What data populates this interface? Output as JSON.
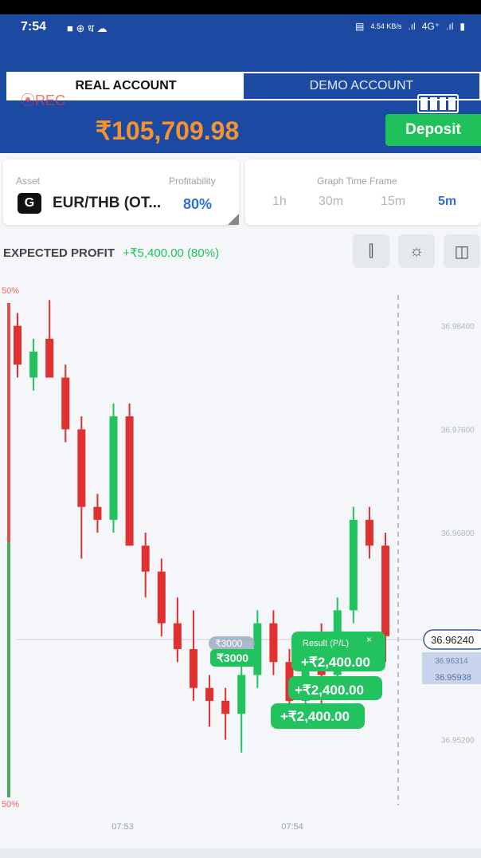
{
  "status": {
    "time": "7:54",
    "network": "4G⁺",
    "speed": "4.54 KB/s"
  },
  "accounts": {
    "real": "REAL ACCOUNT",
    "demo": "DEMO ACCOUNT"
  },
  "rec": "⦿REC",
  "balance": "₹105,709.98",
  "deposit": "Deposit",
  "asset": {
    "label": "Asset",
    "name": "EUR/THB (OT...",
    "icon": "G",
    "profit_label": "Profitability",
    "profit": "80%"
  },
  "timeframe": {
    "label": "Graph Time Frame",
    "options": [
      "1h",
      "30m",
      "15m",
      "5m"
    ],
    "active": "5m"
  },
  "expected_profit": {
    "label": "EXPECTED PROFIT",
    "value": "+₹5,400.00 (80%)"
  },
  "tools": [
    "candles-icon",
    "sun-icon",
    "layout-icon"
  ],
  "chart_data": {
    "type": "candlestick",
    "x_ticks": [
      "07:53",
      "07:54"
    ],
    "y_ticks": [
      "36.98400",
      "36.97600",
      "36.96800",
      "36.95200"
    ],
    "side_labels": [
      "50%",
      "50%"
    ],
    "current_price": "36.96240",
    "price_tags": [
      "36.96314",
      "36.95938"
    ],
    "trades": [
      "₹3000",
      "₹3000"
    ],
    "result_label": "Result (P/L)",
    "results": [
      "+₹2,400.00",
      "+₹2,400.00",
      "+₹2,400.00"
    ],
    "candles": [
      {
        "o": 36.984,
        "h": 36.985,
        "l": 36.98,
        "c": 36.981,
        "up": false
      },
      {
        "o": 36.98,
        "h": 36.983,
        "l": 36.979,
        "c": 36.982,
        "up": true
      },
      {
        "o": 36.983,
        "h": 36.986,
        "l": 36.98,
        "c": 36.98,
        "up": false
      },
      {
        "o": 36.98,
        "h": 36.981,
        "l": 36.975,
        "c": 36.976,
        "up": false
      },
      {
        "o": 36.976,
        "h": 36.977,
        "l": 36.966,
        "c": 36.97,
        "up": false
      },
      {
        "o": 36.97,
        "h": 36.971,
        "l": 36.968,
        "c": 36.969,
        "up": false
      },
      {
        "o": 36.969,
        "h": 36.978,
        "l": 36.968,
        "c": 36.977,
        "up": true
      },
      {
        "o": 36.977,
        "h": 36.978,
        "l": 36.967,
        "c": 36.967,
        "up": false
      },
      {
        "o": 36.967,
        "h": 36.968,
        "l": 36.963,
        "c": 36.965,
        "up": false
      },
      {
        "o": 36.965,
        "h": 36.966,
        "l": 36.96,
        "c": 36.961,
        "up": false
      },
      {
        "o": 36.961,
        "h": 36.963,
        "l": 36.958,
        "c": 36.959,
        "up": false
      },
      {
        "o": 36.959,
        "h": 36.962,
        "l": 36.955,
        "c": 36.956,
        "up": false
      },
      {
        "o": 36.956,
        "h": 36.957,
        "l": 36.953,
        "c": 36.955,
        "up": false
      },
      {
        "o": 36.955,
        "h": 36.956,
        "l": 36.952,
        "c": 36.954,
        "up": false
      },
      {
        "o": 36.954,
        "h": 36.958,
        "l": 36.951,
        "c": 36.957,
        "up": true
      },
      {
        "o": 36.957,
        "h": 36.962,
        "l": 36.956,
        "c": 36.961,
        "up": true
      },
      {
        "o": 36.961,
        "h": 36.962,
        "l": 36.957,
        "c": 36.958,
        "up": false
      },
      {
        "o": 36.958,
        "h": 36.959,
        "l": 36.954,
        "c": 36.955,
        "up": false
      },
      {
        "o": 36.955,
        "h": 36.96,
        "l": 36.953,
        "c": 36.959,
        "up": true
      },
      {
        "o": 36.959,
        "h": 36.961,
        "l": 36.954,
        "c": 36.957,
        "up": false
      },
      {
        "o": 36.957,
        "h": 36.963,
        "l": 36.956,
        "c": 36.962,
        "up": true
      },
      {
        "o": 36.962,
        "h": 36.97,
        "l": 36.961,
        "c": 36.969,
        "up": true
      },
      {
        "o": 36.969,
        "h": 36.97,
        "l": 36.966,
        "c": 36.967,
        "up": false
      },
      {
        "o": 36.967,
        "h": 36.968,
        "l": 36.958,
        "c": 36.96,
        "up": false
      }
    ]
  },
  "colors": {
    "header": "#1c4aa3",
    "up": "#22c35e",
    "down": "#e03131",
    "deposit": "#1fc25a",
    "balance": "#f5932e"
  }
}
